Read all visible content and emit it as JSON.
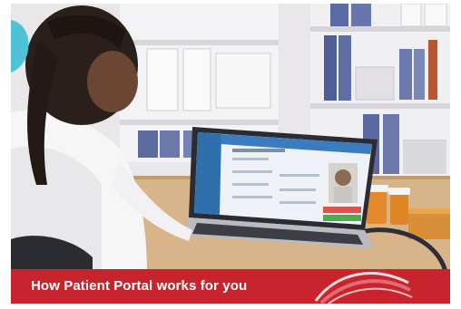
{
  "banner": {
    "text": "How Patient Portal works for you"
  },
  "colors": {
    "banner_red": "#c8242e",
    "teal_accent": "#4fc3d6",
    "portal_blue": "#2f6fae"
  }
}
